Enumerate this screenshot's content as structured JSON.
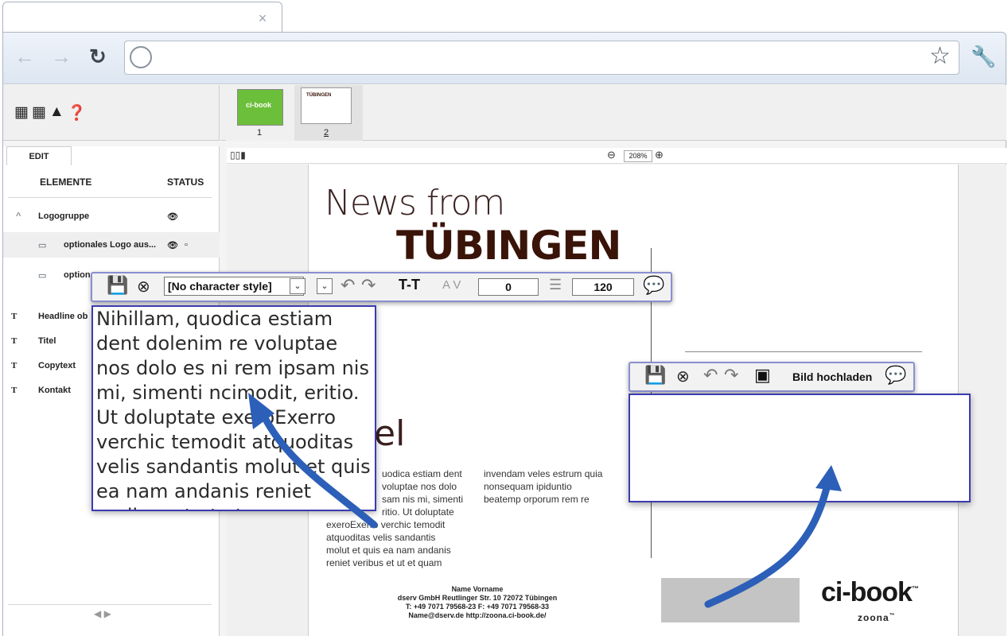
{
  "browser": {
    "tab_close": "×",
    "icons": {
      "back": "back-arrow-icon",
      "forward": "forward-arrow-icon",
      "reload": "reload-icon",
      "globe": "globe-icon",
      "star": "star-icon",
      "wrench": "wrench-icon"
    }
  },
  "app": {
    "thumbnails": [
      {
        "number": "1",
        "label": "ci-book"
      },
      {
        "number": "2",
        "label": "TÜBINGEN"
      }
    ],
    "panel": {
      "tab": "EDIT",
      "col_elements": "ELEMENTE",
      "col_status": "STATUS",
      "rows": [
        {
          "label": "Logogruppe"
        },
        {
          "label": "optionales Logo aus..."
        },
        {
          "label": "option"
        },
        {
          "label": "Headline ob"
        },
        {
          "label": "Titel"
        },
        {
          "label": "Copytext"
        },
        {
          "label": "Kontakt"
        }
      ],
      "pager": "◀ ▶"
    },
    "zoom": "208%"
  },
  "document": {
    "headline1": "News from",
    "headline2": "TÜBINGEN",
    "big_el": "el",
    "col1": [
      "uodica estiam dent",
      "voluptae nos dolo",
      "sam nis mi, simenti",
      "ritio. Ut doluptate",
      "exeroExerro verchic temodit",
      "atquoditas velis sandantis",
      "molut et quis ea nam andanis",
      "reniet veribus et ut et quam"
    ],
    "col2": [
      "invendam veles estrum quia",
      "nonsequam ipiduntio",
      "beatemp orporum rem re"
    ],
    "footer": [
      "Name Vorname",
      "dserv GmbH Reutlinger Str. 10 72072 Tübingen",
      "T: +49 7071 79568-23 F: +49 7071 79568-33",
      "Name@dserv.de http://zoona.ci-book.de/"
    ],
    "logo": "ci-book",
    "logo_tm": "™",
    "logo_sub": "zoona"
  },
  "text_toolbar": {
    "char_style": "[No character style]",
    "tracking": "0",
    "leading": "120"
  },
  "text_editor": {
    "content": "Nihillam, quodica estiam dent dolenim re voluptae nos dolo es ni rem ipsam nis mi, simenti ncimodit, eritio. Ut doluptate exeroExerro verchic temodit atquoditas velis sandantis molut et quis ea nam andanis reniet veribus et ut et quam"
  },
  "image_toolbar": {
    "upload_label": "Bild hochladen"
  },
  "colors": {
    "accent": "#3b3bb0",
    "arrow": "#2c5fb8",
    "headline": "#3a1408"
  }
}
